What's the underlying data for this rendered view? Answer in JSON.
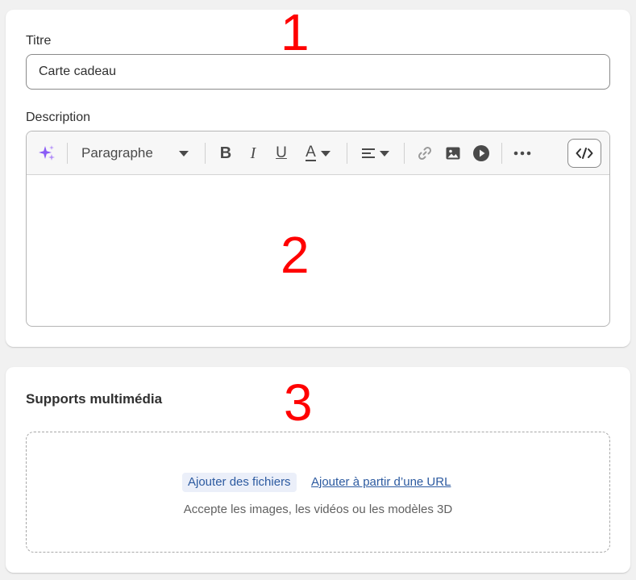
{
  "product": {
    "title_label": "Titre",
    "title_value": "Carte cadeau",
    "description_label": "Description"
  },
  "editor": {
    "format_select": "Paragraphe",
    "icons": {
      "ai": "sparkle-icon",
      "bold": "bold-icon",
      "italic": "italic-icon",
      "underline": "underline-icon",
      "text_color": "text-color-icon",
      "align": "align-left-icon",
      "link": "link-icon",
      "image": "image-icon",
      "video": "video-play-icon",
      "more": "more-horizontal-icon",
      "code": "code-icon"
    },
    "bold_glyph": "B",
    "italic_glyph": "I",
    "underline_glyph": "U",
    "text_color_glyph": "A",
    "content": ""
  },
  "media": {
    "title": "Supports multimédia",
    "add_files": "Ajouter des fichiers",
    "add_url": "Ajouter à partir d’une URL",
    "accept_text": "Accepte les images, les vidéos ou les modèles 3D"
  },
  "markers": [
    "1",
    "2",
    "3"
  ],
  "colors": {
    "link": "#2c5aa0",
    "marker": "#ff0000",
    "ai_sparkle": "#8a5cf6"
  }
}
